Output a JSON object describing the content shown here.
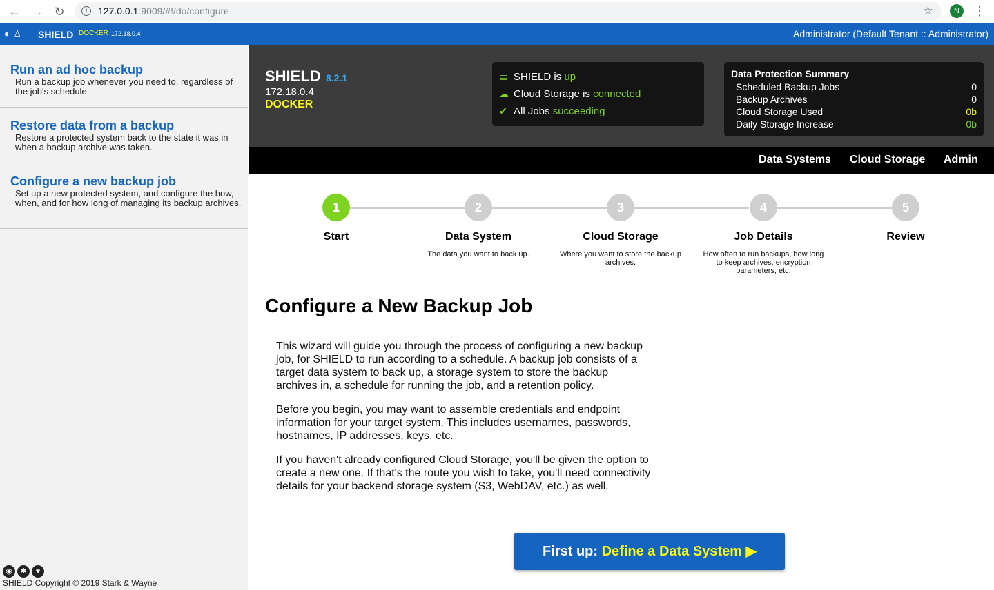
{
  "browser": {
    "url_host": "127.0.0.1",
    "url_rest": ":9009/#!/do/configure",
    "profile_initial": "N"
  },
  "topbar": {
    "brand": "SHIELD",
    "env": "DOCKER",
    "ip": "172.18.0.4",
    "user": "Administrator (Default Tenant :: Administrator)"
  },
  "sidebar": {
    "items": [
      {
        "title": "Run an ad hoc backup",
        "desc": "Run a backup job whenever you need to, regardless of the job's schedule."
      },
      {
        "title": "Restore data from a backup",
        "desc": "Restore a protected system back to the state it was in when a backup archive was taken."
      },
      {
        "title": "Configure a new backup job",
        "desc": "Set up a new protected system, and configure the how, when, and for how long of managing its backup archives."
      }
    ],
    "footer_icons": [
      "github-icon",
      "settings-icon",
      "twitter-icon"
    ],
    "copyright": "SHIELD Copyright © 2019 Stark & Wayne"
  },
  "header": {
    "title": "SHIELD",
    "version": "8.2.1",
    "ip": "172.18.0.4",
    "env": "DOCKER",
    "status": [
      {
        "icon": "server-icon",
        "text": "SHIELD is ",
        "state": "up"
      },
      {
        "icon": "cloud-icon",
        "text": "Cloud Storage is ",
        "state": "connected"
      },
      {
        "icon": "check-icon",
        "text": "All Jobs ",
        "state": "succeeding"
      }
    ],
    "summary": {
      "title": "Data Protection Summary",
      "rows": [
        {
          "label": "Scheduled Backup Jobs",
          "value": "0"
        },
        {
          "label": "Backup Archives",
          "value": "0"
        },
        {
          "label": "Cloud Storage Used",
          "value": "0b"
        },
        {
          "label": "Daily Storage Increase",
          "value": "0b"
        }
      ]
    }
  },
  "nav": {
    "items": [
      "Data Systems",
      "Cloud Storage",
      "Admin"
    ]
  },
  "wizard": {
    "steps": [
      {
        "num": "1",
        "label": "Start",
        "desc": "",
        "active": true
      },
      {
        "num": "2",
        "label": "Data System",
        "desc": "The data you want to back up."
      },
      {
        "num": "3",
        "label": "Cloud Storage",
        "desc": "Where you want to store the backup archives."
      },
      {
        "num": "4",
        "label": "Job Details",
        "desc": "How often to run backups, how long to keep archives, encryption parameters, etc."
      },
      {
        "num": "5",
        "label": "Review",
        "desc": ""
      }
    ]
  },
  "main": {
    "title": "Configure a New Backup Job",
    "paragraphs": [
      "This wizard will guide you through the process of configuring a new backup job, for SHIELD to run according to a schedule. A backup job consists of a target data system to back up, a storage system to store the backup archives in, a schedule for running the job, and a retention policy.",
      "Before you begin, you may want to assemble credentials and endpoint information for your target system. This includes usernames, passwords, hostnames, IP addresses, keys, etc.",
      "If you haven't already configured Cloud Storage, you'll be given the option to create a new one. If that's the route you wish to take, you'll need connectivity details for your backend storage system (S3, WebDAV, etc.) as well."
    ],
    "cta_prefix": "First up: ",
    "cta_action": "Define a Data System ▶"
  },
  "colors": {
    "brand_blue": "#1565c0",
    "accent_green": "#7ed321",
    "accent_yellow": "#f6f616"
  }
}
